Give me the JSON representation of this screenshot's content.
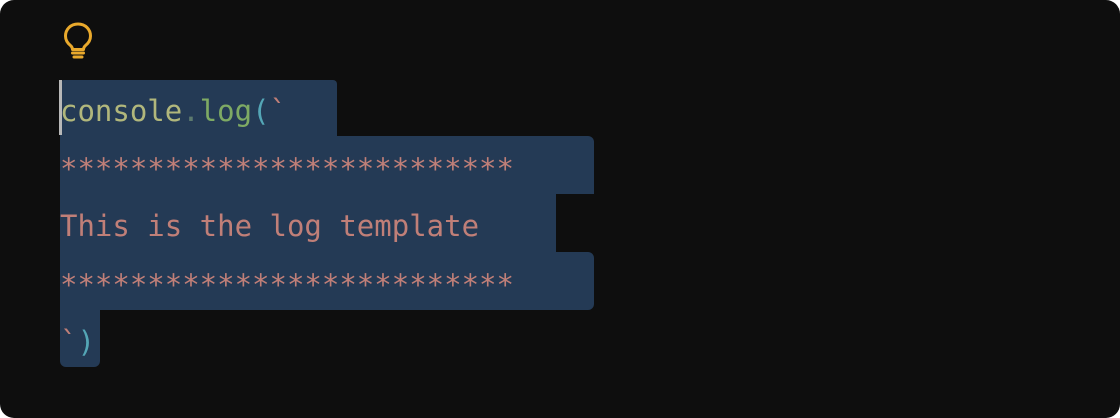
{
  "code": {
    "line1": {
      "ident": "console",
      "dot": ".",
      "fn": "log",
      "paren_open": "(",
      "tick_open": "`"
    },
    "line2": "**************************",
    "line3": "This is the log template",
    "line4": "**************************",
    "line5": {
      "tick_close": "`",
      "paren_close": ")"
    }
  },
  "icons": {
    "lightbulb": "lightbulb-icon"
  },
  "colors": {
    "background": "#0e0e0e",
    "selection": "#243a55",
    "lightbulb": "#e9a92c",
    "identifier": "#b1b77c",
    "function": "#7eaa64",
    "paren": "#54a6b6",
    "string": "#c07f78"
  }
}
